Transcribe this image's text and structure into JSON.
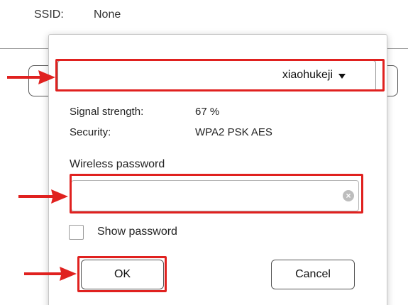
{
  "background": {
    "ssid_label": "SSID:",
    "ssid_value": "None"
  },
  "dialog": {
    "network_select": {
      "selected": "xiaohukeji",
      "caret_icon": "triangle-down-icon"
    },
    "info": {
      "signal_label": "Signal strength:",
      "signal_value": "67 %",
      "security_label": "Security:",
      "security_value": "WPA2 PSK AES"
    },
    "password": {
      "label": "Wireless password",
      "value": "",
      "clear_icon": "clear-circle-icon"
    },
    "show_password": {
      "label": "Show password",
      "checked": false
    },
    "buttons": {
      "ok_label": "OK",
      "cancel_label": "Cancel"
    }
  },
  "annotations": {
    "highlight_color": "#e0211f",
    "arrow_icon": "red-arrow-icon"
  }
}
